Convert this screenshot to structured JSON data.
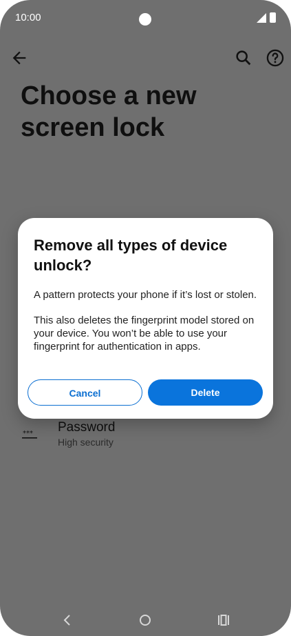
{
  "status_bar": {
    "time": "10:00"
  },
  "screen": {
    "title": "Choose a new screen lock"
  },
  "list": {
    "password": {
      "title": "Password",
      "subtitle": "High security"
    }
  },
  "dialog": {
    "title": "Remove all types of device unlock?",
    "body": [
      "A pattern protects your phone if it’s lost or stolen.",
      "This also deletes the fingerprint model stored on your device. You won’t be able to use your fingerprint for authentication in apps."
    ],
    "cancel_label": "Cancel",
    "delete_label": "Delete"
  },
  "icons": {
    "back": "arrow-back-icon",
    "search": "search-icon",
    "help": "help-icon",
    "password": "password-icon",
    "nav_back": "nav-back-icon",
    "nav_home": "nav-home-icon",
    "nav_recents": "nav-recents-icon"
  },
  "colors": {
    "scrim_background": "#6f6f6f",
    "primary_button": "#0a74dc",
    "outline_button": "#0a6ed1"
  }
}
